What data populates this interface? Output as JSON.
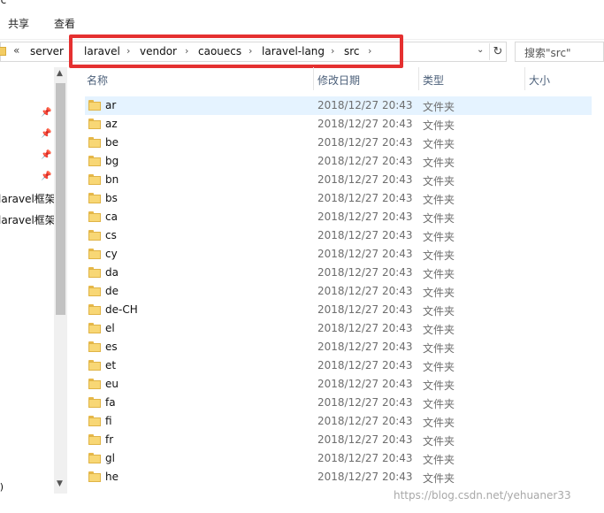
{
  "window": {
    "title": "rc"
  },
  "ribbon": {
    "tabs": [
      "共享",
      "查看"
    ]
  },
  "address": {
    "overflow": "«",
    "prefix": "server",
    "crumbs": [
      "laravel",
      "vendor",
      "caouecs",
      "laravel-lang",
      "src"
    ],
    "separator": "›"
  },
  "search": {
    "placeholder": "搜索\"src\""
  },
  "nav": {
    "items": [
      "laravel框架",
      "laravel框架"
    ],
    "drive": ":)"
  },
  "columns": {
    "name": "名称",
    "date": "修改日期",
    "type": "类型",
    "size": "大小"
  },
  "files": [
    {
      "name": "ar",
      "date": "2018/12/27 20:43",
      "type": "文件夹",
      "selected": true
    },
    {
      "name": "az",
      "date": "2018/12/27 20:43",
      "type": "文件夹"
    },
    {
      "name": "be",
      "date": "2018/12/27 20:43",
      "type": "文件夹"
    },
    {
      "name": "bg",
      "date": "2018/12/27 20:43",
      "type": "文件夹"
    },
    {
      "name": "bn",
      "date": "2018/12/27 20:43",
      "type": "文件夹"
    },
    {
      "name": "bs",
      "date": "2018/12/27 20:43",
      "type": "文件夹"
    },
    {
      "name": "ca",
      "date": "2018/12/27 20:43",
      "type": "文件夹"
    },
    {
      "name": "cs",
      "date": "2018/12/27 20:43",
      "type": "文件夹"
    },
    {
      "name": "cy",
      "date": "2018/12/27 20:43",
      "type": "文件夹"
    },
    {
      "name": "da",
      "date": "2018/12/27 20:43",
      "type": "文件夹"
    },
    {
      "name": "de",
      "date": "2018/12/27 20:43",
      "type": "文件夹"
    },
    {
      "name": "de-CH",
      "date": "2018/12/27 20:43",
      "type": "文件夹"
    },
    {
      "name": "el",
      "date": "2018/12/27 20:43",
      "type": "文件夹"
    },
    {
      "name": "es",
      "date": "2018/12/27 20:43",
      "type": "文件夹"
    },
    {
      "name": "et",
      "date": "2018/12/27 20:43",
      "type": "文件夹"
    },
    {
      "name": "eu",
      "date": "2018/12/27 20:43",
      "type": "文件夹"
    },
    {
      "name": "fa",
      "date": "2018/12/27 20:43",
      "type": "文件夹"
    },
    {
      "name": "fi",
      "date": "2018/12/27 20:43",
      "type": "文件夹"
    },
    {
      "name": "fr",
      "date": "2018/12/27 20:43",
      "type": "文件夹"
    },
    {
      "name": "gl",
      "date": "2018/12/27 20:43",
      "type": "文件夹"
    },
    {
      "name": "he",
      "date": "2018/12/27 20:43",
      "type": "文件夹"
    }
  ],
  "watermark": "https://blog.csdn.net/yehuaner33",
  "colors": {
    "highlight": "#e53030",
    "selection": "#e5f3ff",
    "folder": "#f8d775"
  }
}
